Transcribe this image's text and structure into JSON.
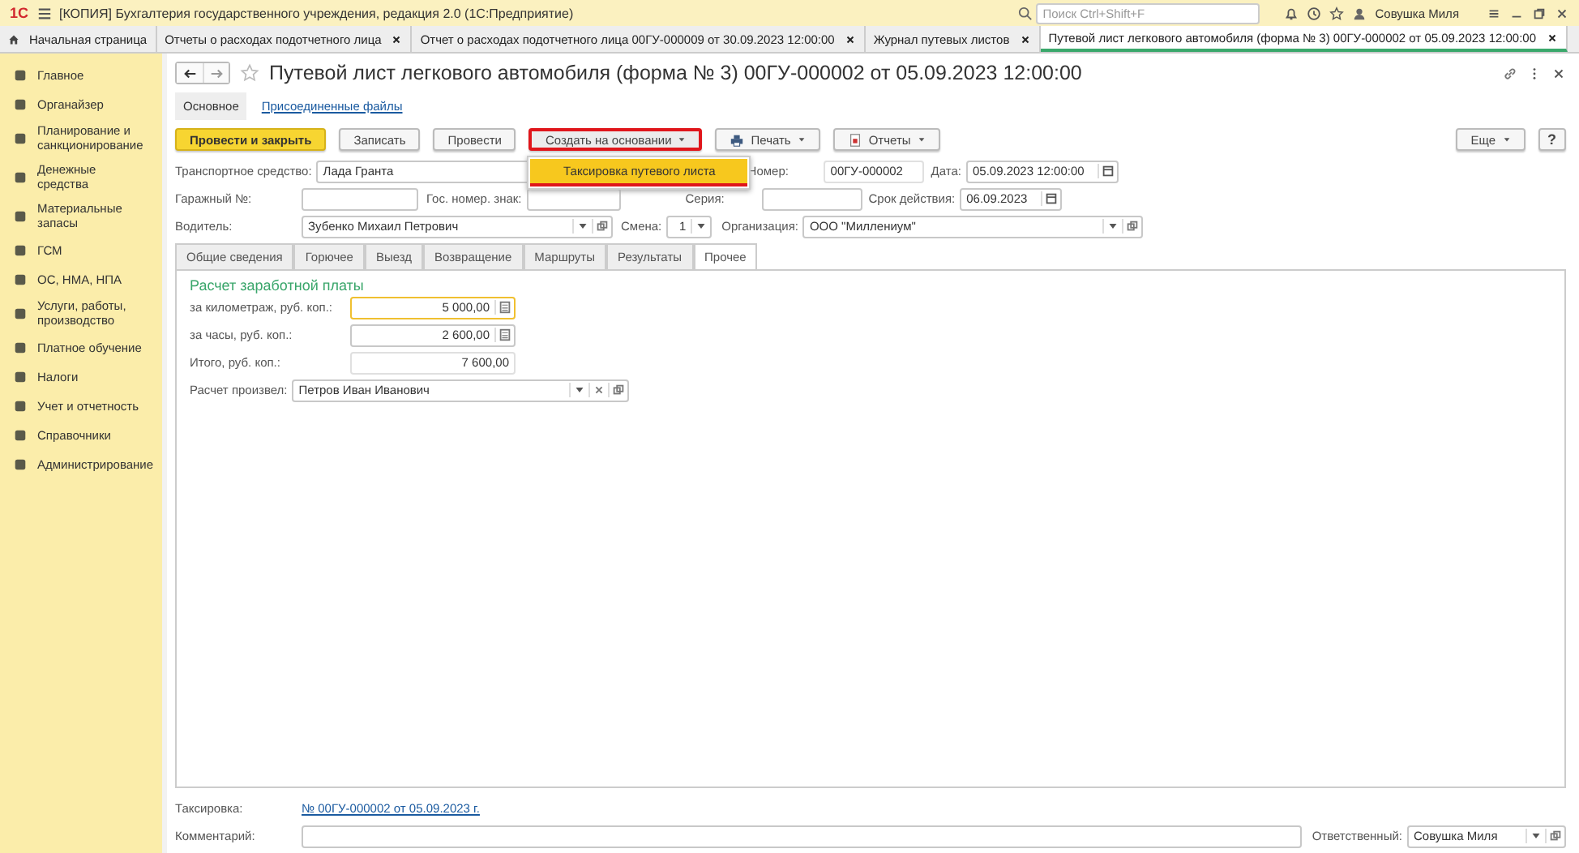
{
  "app": {
    "logo": "1С",
    "title": "[КОПИЯ] Бухгалтерия государственного учреждения, редакция 2.0  (1С:Предприятие)",
    "search_placeholder": "Поиск Ctrl+Shift+F",
    "user": "Совушка Миля"
  },
  "open_tabs": [
    {
      "label": "Начальная страница",
      "kind": "home",
      "selected": false
    },
    {
      "label": "Отчеты о расходах подотчетного лица",
      "kind": "doc",
      "selected": false
    },
    {
      "label": "Отчет о расходах подотчетного лица 00ГУ-000009 от 30.09.2023 12:00:00",
      "kind": "doc",
      "selected": false
    },
    {
      "label": "Журнал путевых листов",
      "kind": "doc",
      "selected": false
    },
    {
      "label": "Путевой лист легкового автомобиля (форма № 3) 00ГУ-000002 от 05.09.2023 12:00:00",
      "kind": "doc",
      "selected": true
    }
  ],
  "sidebar": {
    "items": [
      {
        "label": "Главное"
      },
      {
        "label": "Органайзер"
      },
      {
        "label": "Планирование и санкционирование"
      },
      {
        "label": "Денежные средства"
      },
      {
        "label": "Материальные запасы"
      },
      {
        "label": "ГСМ"
      },
      {
        "label": "ОС, НМА, НПА"
      },
      {
        "label": "Услуги, работы, производство"
      },
      {
        "label": "Платное обучение"
      },
      {
        "label": "Налоги"
      },
      {
        "label": "Учет и отчетность"
      },
      {
        "label": "Справочники"
      },
      {
        "label": "Администрирование"
      }
    ]
  },
  "document": {
    "title": "Путевой лист легкового автомобиля (форма № 3) 00ГУ-000002 от 05.09.2023 12:00:00",
    "form_tabs": [
      {
        "label": "Основное",
        "selected": true
      },
      {
        "label": "Присоединенные файлы",
        "selected": false
      }
    ],
    "commands": [
      {
        "label": "Провести и закрыть",
        "kind": "primary",
        "highlighted": false
      },
      {
        "label": "Записать",
        "kind": "plain",
        "highlighted": false
      },
      {
        "label": "Провести",
        "kind": "plain",
        "highlighted": false
      },
      {
        "label": "Создать на основании",
        "kind": "menu",
        "highlighted": true
      },
      {
        "label": "Печать",
        "kind": "print",
        "highlighted": false
      },
      {
        "label": "Отчеты",
        "kind": "report",
        "highlighted": false
      }
    ],
    "dropdown": {
      "items": [
        {
          "label": "Таксировка путевого листа",
          "highlighted": true
        }
      ]
    },
    "more_button": "Еще",
    "help_button": "?",
    "vehicle": {
      "label": "Транспортное средство:",
      "value": "Лада Гранта"
    },
    "number": {
      "label": "Номер:",
      "value": "00ГУ-000002"
    },
    "date": {
      "label": "Дата:",
      "value": "05.09.2023 12:00:00"
    },
    "garage_no": {
      "label": "Гаражный №:"
    },
    "plate": {
      "label": "Гос. номер. знак:"
    },
    "series": {
      "label": "Серия:"
    },
    "valid_until": {
      "label": "Срок действия:",
      "value": "06.09.2023"
    },
    "driver": {
      "label": "Водитель:",
      "value": "Зубенко Михаил Петрович"
    },
    "shift": {
      "label": "Смена:",
      "value": "1"
    },
    "organization": {
      "label": "Организация:",
      "value": "ООО \"Миллениум\""
    },
    "section_tabs": [
      {
        "label": "Общие сведения",
        "selected": false
      },
      {
        "label": "Горючее",
        "selected": false
      },
      {
        "label": "Выезд",
        "selected": false
      },
      {
        "label": "Возвращение",
        "selected": false
      },
      {
        "label": "Маршруты",
        "selected": false
      },
      {
        "label": "Результаты",
        "selected": false
      },
      {
        "label": "Прочее",
        "selected": true
      }
    ],
    "salary": {
      "heading": "Расчет заработной платы",
      "fields": [
        {
          "label": "за километраж, руб. коп.:",
          "value": "5 000,00",
          "kind": "calc",
          "focused": true
        },
        {
          "label": "за часы, руб. коп.:",
          "value": "2 600,00",
          "kind": "calc",
          "focused": false
        },
        {
          "label": "Итого, руб. коп.:",
          "value": "7 600,00",
          "kind": "readonly",
          "focused": false
        }
      ],
      "calculated_by": {
        "label": "Расчет произвел:",
        "value": "Петров Иван Иванович"
      }
    },
    "footer": {
      "taxing": {
        "label": "Таксировка:",
        "link": "№ 00ГУ-000002 от 05.09.2023 г."
      },
      "comment": {
        "label": "Комментарий:"
      },
      "responsible": {
        "label": "Ответственный:",
        "value": "Совушка Миля"
      }
    }
  }
}
